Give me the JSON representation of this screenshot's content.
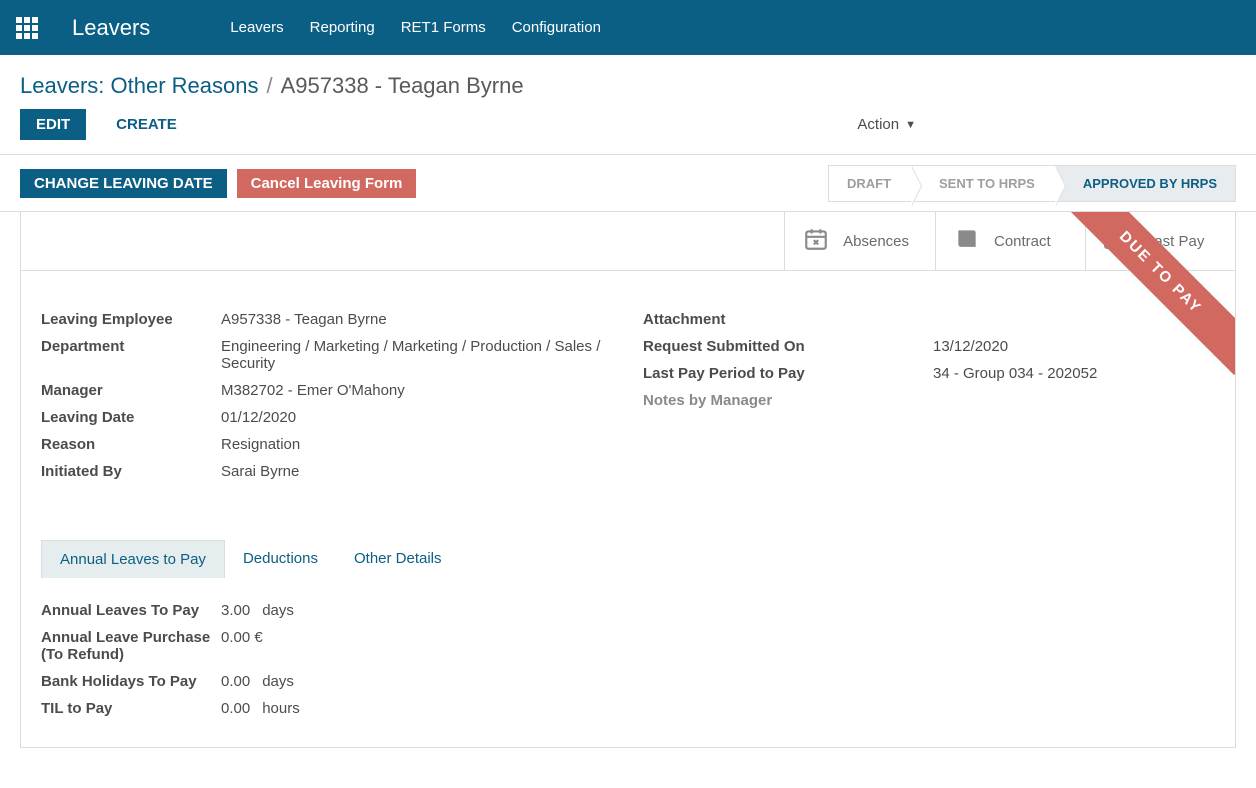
{
  "nav": {
    "app_title": "Leavers",
    "items": [
      "Leavers",
      "Reporting",
      "RET1 Forms",
      "Configuration"
    ]
  },
  "breadcrumb": {
    "root": "Leavers: Other Reasons",
    "current": "A957338 - Teagan Byrne"
  },
  "actions": {
    "edit": "EDIT",
    "create": "CREATE",
    "action_label": "Action",
    "change_leaving_date": "CHANGE LEAVING DATE",
    "cancel_leaving_form": "Cancel Leaving Form"
  },
  "stages": {
    "draft": "DRAFT",
    "sent": "SENT TO HRPS",
    "approved": "APPROVED BY HRPS"
  },
  "stat_buttons": {
    "absences": "Absences",
    "contract": "Contract",
    "last_pay": "Last Pay"
  },
  "ribbon": "DUE TO PAY",
  "details": {
    "left": {
      "leaving_employee_label": "Leaving Employee",
      "leaving_employee": "A957338 - Teagan Byrne",
      "department_label": "Department",
      "department": "Engineering / Marketing / Marketing / Production / Sales / Security",
      "manager_label": "Manager",
      "manager": "M382702 - Emer O'Mahony",
      "leaving_date_label": "Leaving Date",
      "leaving_date": "01/12/2020",
      "reason_label": "Reason",
      "reason": "Resignation",
      "initiated_by_label": "Initiated By",
      "initiated_by": "Sarai Byrne"
    },
    "right": {
      "attachment_label": "Attachment",
      "request_submitted_label": "Request Submitted On",
      "request_submitted": "13/12/2020",
      "last_pay_period_label": "Last Pay Period to Pay",
      "last_pay_period": "34 - Group 034 - 202052",
      "notes_label": "Notes by Manager"
    }
  },
  "tabs": {
    "t1": "Annual Leaves to Pay",
    "t2": "Deductions",
    "t3": "Other Details"
  },
  "tab_body": {
    "annual_leaves_label": "Annual Leaves To Pay",
    "annual_leaves_val": "3.00",
    "annual_leaves_unit": "days",
    "al_purchase_label": "Annual Leave Purchase (To Refund)",
    "al_purchase_val": "0.00 €",
    "bank_hol_label": "Bank Holidays To Pay",
    "bank_hol_val": "0.00",
    "bank_hol_unit": "days",
    "til_label": "TIL to Pay",
    "til_val": "0.00",
    "til_unit": "hours"
  }
}
